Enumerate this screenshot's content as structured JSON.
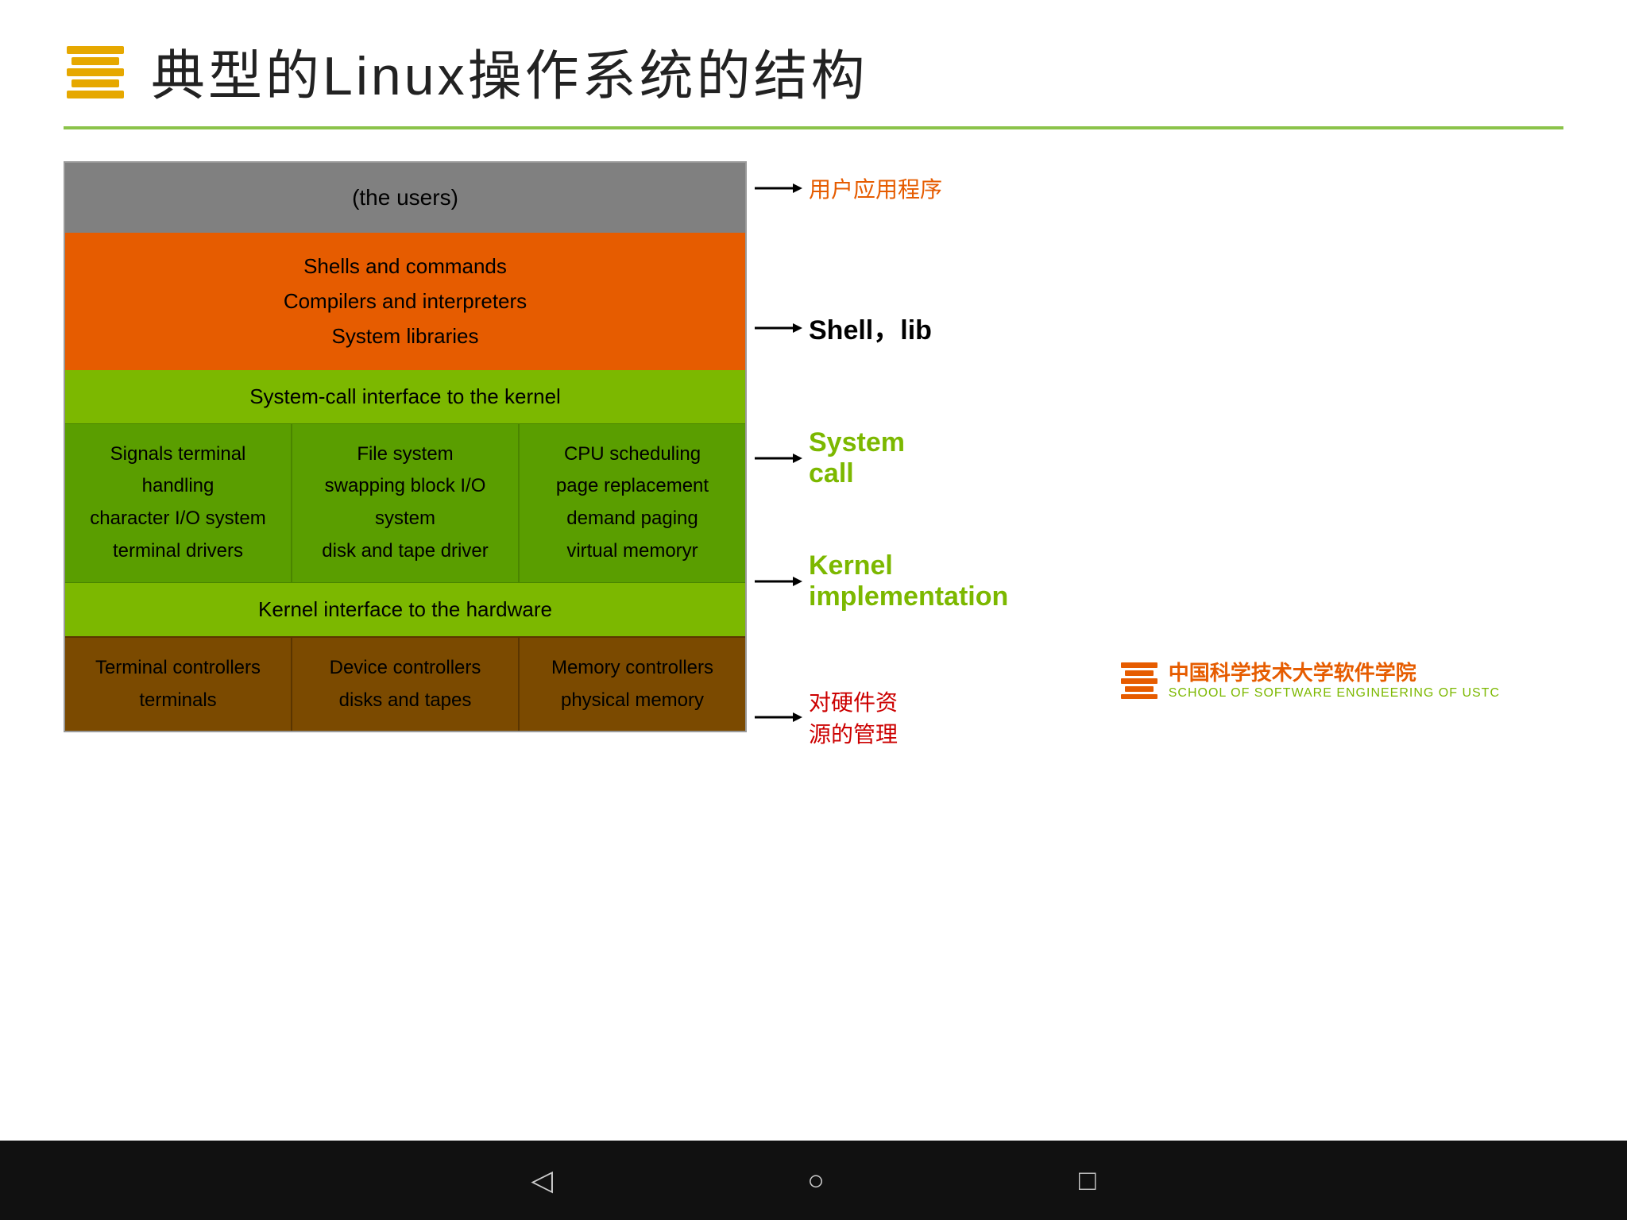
{
  "slide": {
    "title": "典型的Linux操作系统的结构",
    "divider_color": "#8bc34a"
  },
  "diagram": {
    "users_layer": "(the users)",
    "orange_layer": {
      "line1": "Shells and commands",
      "line2": "Compilers and interpreters",
      "line3": "System libraries"
    },
    "syscall_layer": "System-call interface to the kernel",
    "kernel_cells": [
      {
        "line1": "Signals terminal",
        "line2": "handling",
        "line3": "character I/O system",
        "line4": "terminal    drivers"
      },
      {
        "line1": "File system",
        "line2": "swapping block I/O",
        "line3": "system",
        "line4": "disk and tape driver"
      },
      {
        "line1": "CPU scheduling",
        "line2": "page replacement",
        "line3": "demand paging",
        "line4": "virtual memoryr"
      }
    ],
    "hw_interface_layer": "Kernel interface to the hardware",
    "hw_cells": [
      {
        "line1": "Terminal controllers",
        "line2": "terminals"
      },
      {
        "line1": "Device controllers",
        "line2": "disks and tapes"
      },
      {
        "line1": "Memory controllers",
        "line2": "physical memory"
      }
    ]
  },
  "labels": [
    {
      "id": "users-label",
      "text": "用户应用程序",
      "color": "#e65c00",
      "style": "orange"
    },
    {
      "id": "shell-label",
      "line1": "Shell，lib",
      "color": "#000",
      "style": "black-bold"
    },
    {
      "id": "syscall-label",
      "line1": "System",
      "line2": "call",
      "color": "#7cb800",
      "style": "green-bold"
    },
    {
      "id": "kernel-label",
      "line1": "Kernel",
      "line2": "implementation",
      "color": "#7cb800",
      "style": "green-bold"
    },
    {
      "id": "hw-label",
      "line1": "对硬件资",
      "line2": "源的管理",
      "color": "#cc0000",
      "style": "red"
    }
  ],
  "school": {
    "cn_name": "中国科学技术大学软件学院",
    "en_name": "SCHOOL OF SOFTWARE ENGINEERING OF USTC"
  },
  "navbar": {
    "back": "◁",
    "home": "○",
    "recent": "□"
  }
}
